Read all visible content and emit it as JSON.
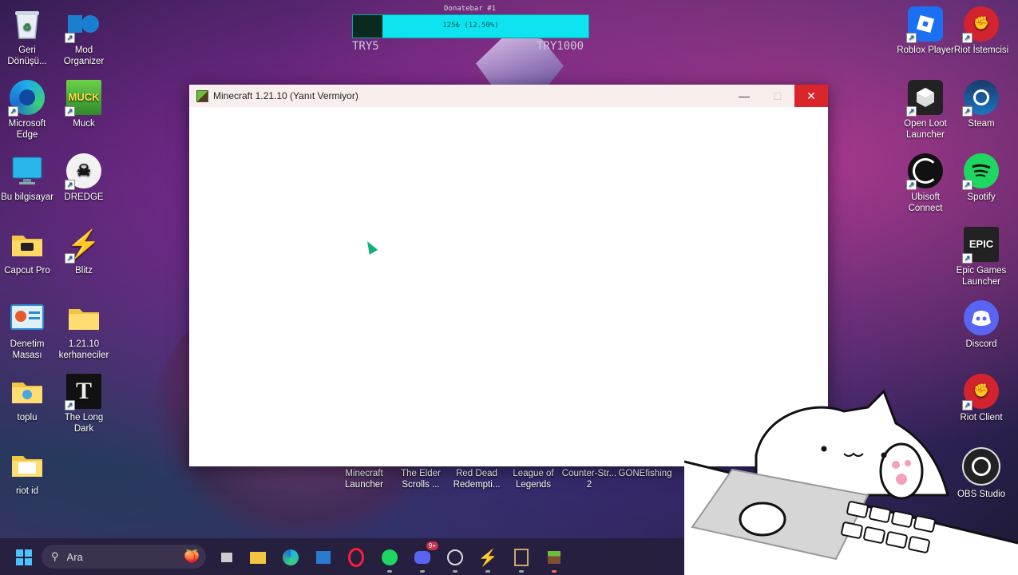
{
  "donation": {
    "title": "Donatebar #1",
    "bar_text": "125₺ (12.50%)",
    "progress_fraction": 0.125,
    "min_label": "TRY5",
    "max_label": "TRY1000"
  },
  "window": {
    "title": "Minecraft 1.21.10 (Yanıt Vermiyor)",
    "minimize_icon": "minimize-icon",
    "maximize_icon": "maximize-icon",
    "close_icon": "close-icon"
  },
  "desktop_left": [
    {
      "label": "Geri Dönüşü...",
      "icon": "recycle-bin-icon"
    },
    {
      "label": "Mod Organizer",
      "icon": "mod-organizer-icon"
    },
    {
      "label": "Microsoft Edge",
      "icon": "edge-icon"
    },
    {
      "label": "Muck",
      "icon": "muck-icon"
    },
    {
      "label": "Bu bilgisayar",
      "icon": "computer-icon"
    },
    {
      "label": "DREDGE",
      "icon": "dredge-icon"
    },
    {
      "label": "Capcut Pro",
      "icon": "folder-icon"
    },
    {
      "label": "Blitz",
      "icon": "blitz-icon"
    },
    {
      "label": "Denetim Masası",
      "icon": "control-panel-icon"
    },
    {
      "label": "1.21.10 kerhaneciler",
      "icon": "folder-icon"
    },
    {
      "label": "toplu",
      "icon": "folder-icon"
    },
    {
      "label": "The Long Dark",
      "icon": "the-long-dark-icon"
    },
    {
      "label": "riot id",
      "icon": "folder-icon"
    }
  ],
  "desktop_right": [
    {
      "label": "Roblox Player",
      "icon": "roblox-icon"
    },
    {
      "label": "Riot İstemcisi",
      "icon": "riot-icon"
    },
    {
      "label": "Open Loot Launcher",
      "icon": "open-loot-icon"
    },
    {
      "label": "Steam",
      "icon": "steam-icon"
    },
    {
      "label": "Ubisoft Connect",
      "icon": "ubisoft-icon"
    },
    {
      "label": "Spotify",
      "icon": "spotify-icon"
    },
    {
      "label": "Epic Games Launcher",
      "icon": "epic-games-icon"
    },
    {
      "label": "Discord",
      "icon": "discord-icon"
    },
    {
      "label": "Riot Client",
      "icon": "riot-icon"
    },
    {
      "label": "OBS Studio",
      "icon": "obs-icon"
    }
  ],
  "desktop_bottom": [
    {
      "label": "Minecraft Launcher",
      "icon": "minecraft-icon"
    },
    {
      "label": "The Elder Scrolls ...",
      "icon": "elder-scrolls-icon"
    },
    {
      "label": "Red Dead Redempti...",
      "icon": "red-dead-icon"
    },
    {
      "label": "League of Legends",
      "icon": "league-icon"
    },
    {
      "label": "Counter-Str... 2",
      "icon": "counter-strike-icon"
    },
    {
      "label": "GONEfishing",
      "icon": "gonefishing-icon"
    }
  ],
  "taskbar": {
    "search_placeholder": "Ara",
    "discord_badge": "9+"
  },
  "colors": {
    "close_button": "#d9262a",
    "donate_bar": "#0de4ef",
    "cursor": "#0fb07a"
  }
}
